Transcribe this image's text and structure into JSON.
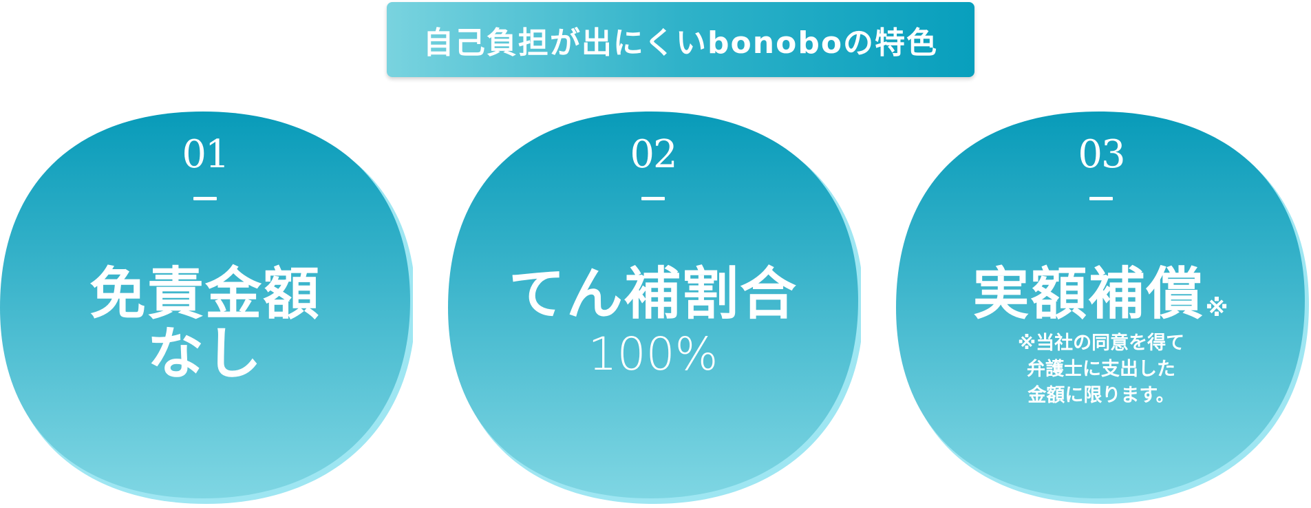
{
  "header": {
    "title": "自己負担が出にくいbonoboの特色"
  },
  "features": [
    {
      "number": "01",
      "title_line1": "免責金額",
      "title_line2": "なし"
    },
    {
      "number": "02",
      "title": "てん補割合",
      "subtitle": "100%"
    },
    {
      "number": "03",
      "title": "実額補償",
      "title_mark": "※",
      "note_line1": "※当社の同意を得て",
      "note_line2": "弁護士に支出した",
      "note_line3": "金額に限ります。"
    }
  ],
  "colors": {
    "blob_top": "#089bb9",
    "blob_bottom": "#7fd6e3",
    "blob_shadow": "#9ee6f2",
    "header_left": "#79d3df",
    "header_right": "#089fbd"
  }
}
